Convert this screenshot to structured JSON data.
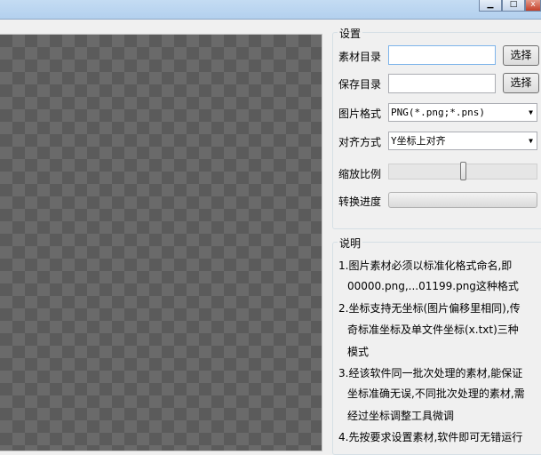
{
  "settings": {
    "title": "设置",
    "source_dir_label": "素材目录",
    "source_dir_value": "",
    "select_label": "选择",
    "save_dir_label": "保存目录",
    "save_dir_value": "",
    "format_label": "图片格式",
    "format_value": "PNG(*.png;*.pns)",
    "align_label": "对齐方式",
    "align_value": "Y坐标上对齐",
    "scale_label": "缩放比例",
    "scale_value": 0.5,
    "progress_label": "转换进度",
    "progress_value": 0
  },
  "notes": {
    "title": "说明",
    "lines": [
      "1.图片素材必须以标准化格式命名,即",
      "00000.png,...01199.png这种格式",
      "2.坐标支持无坐标(图片偏移里相同),传",
      "奇标准坐标及单文件坐标(x.txt)三种",
      "模式",
      "3.经该软件同一批次处理的素材,能保证",
      "坐标准确无误,不同批次处理的素材,需",
      "经过坐标调整工具微调",
      "4.先按要求设置素材,软件即可无错运行"
    ]
  }
}
